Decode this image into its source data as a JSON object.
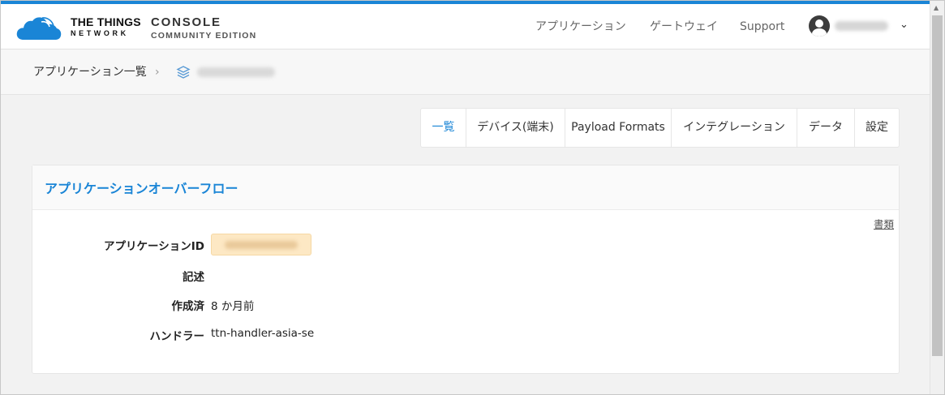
{
  "brand": {
    "ttn_line1": "THE THINGS",
    "ttn_line2": "NETWORK",
    "console_line1": "CONSOLE",
    "console_line2": "COMMUNITY EDITION"
  },
  "topnav": {
    "applications": "アプリケーション",
    "gateways": "ゲートウェイ",
    "support": "Support",
    "user_caret": "⌄"
  },
  "breadcrumb": {
    "root": "アプリケーション一覧",
    "separator": "›"
  },
  "tabs": [
    {
      "label": "一覧",
      "active": true
    },
    {
      "label": "デバイス(端末)",
      "active": false
    },
    {
      "label": "Payload Formats",
      "active": false
    },
    {
      "label": "インテグレーション",
      "active": false
    },
    {
      "label": "データ",
      "active": false
    },
    {
      "label": "設定",
      "active": false
    }
  ],
  "overview": {
    "title": "アプリケーションオーバーフロー",
    "doc_link": "書類",
    "fields": {
      "app_id_label": "アプリケーションID",
      "description_label": "記述",
      "created_label": "作成済",
      "created_value": "8 か月前",
      "handler_label": "ハンドラー",
      "handler_value": "ttn-handler-asia-se"
    }
  },
  "colors": {
    "accent": "#1a85d6",
    "id_chip": "#fde8c4"
  }
}
